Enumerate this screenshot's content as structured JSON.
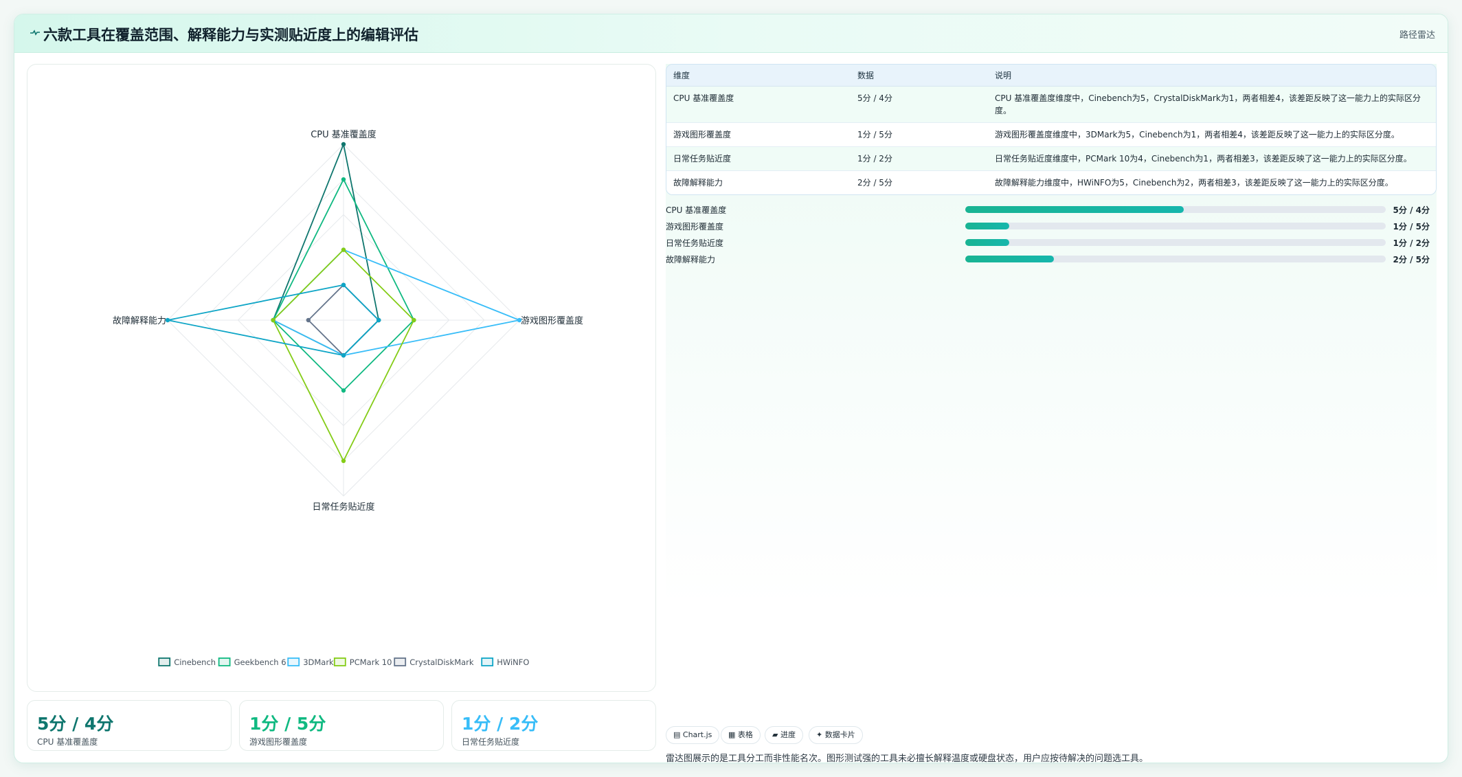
{
  "header": {
    "title": "六款工具在覆盖范围、解释能力与实测贴近度上的编辑评估",
    "tag": "路径雷达"
  },
  "chart_data": {
    "type": "radar",
    "axes": [
      "CPU 基准覆盖度",
      "游戏图形覆盖度",
      "日常任务贴近度",
      "故障解释能力"
    ],
    "range": [
      0,
      5
    ],
    "grid_levels": 5,
    "legend_position": "bottom",
    "series": [
      {
        "name": "Cinebench",
        "values": [
          5,
          1,
          1,
          2
        ],
        "color": "#0f766e"
      },
      {
        "name": "Geekbench 6",
        "values": [
          4,
          2,
          2,
          2
        ],
        "color": "#10b981"
      },
      {
        "name": "3DMark",
        "values": [
          2,
          5,
          1,
          2
        ],
        "color": "#38bdf8"
      },
      {
        "name": "PCMark 10",
        "values": [
          2,
          2,
          4,
          2
        ],
        "color": "#84cc16"
      },
      {
        "name": "CrystalDiskMark",
        "values": [
          1,
          1,
          1,
          1
        ],
        "color": "#64748b"
      },
      {
        "name": "HWiNFO",
        "values": [
          1,
          1,
          1,
          5
        ],
        "color": "#0ea5c6"
      }
    ]
  },
  "table": {
    "headers": [
      "维度",
      "数据",
      "说明"
    ],
    "rows": [
      [
        "CPU 基准覆盖度",
        "5分 / 4分",
        "CPU 基准覆盖度维度中，Cinebench为5，CrystalDiskMark为1，两者相差4，该差距反映了这一能力上的实际区分度。"
      ],
      [
        "游戏图形覆盖度",
        "1分 / 5分",
        "游戏图形覆盖度维度中，3DMark为5，Cinebench为1，两者相差4，该差距反映了这一能力上的实际区分度。"
      ],
      [
        "日常任务贴近度",
        "1分 / 2分",
        "日常任务贴近度维度中，PCMark 10为4，Cinebench为1，两者相差3，该差距反映了这一能力上的实际区分度。"
      ],
      [
        "故障解释能力",
        "2分 / 5分",
        "故障解释能力维度中，HWiNFO为5，Cinebench为2，两者相差3，该差距反映了这一能力上的实际区分度。"
      ]
    ]
  },
  "progress": [
    {
      "label": "CPU 基准覆盖度",
      "value": "5分 / 4分",
      "fraction": 0.52
    },
    {
      "label": "游戏图形覆盖度",
      "value": "1分 / 5分",
      "fraction": 0.105
    },
    {
      "label": "日常任务贴近度",
      "value": "1分 / 2分",
      "fraction": 0.105
    },
    {
      "label": "故障解释能力",
      "value": "2分 / 5分",
      "fraction": 0.21
    }
  ],
  "stats": [
    {
      "value": "5分 / 4分",
      "label": "CPU 基准覆盖度",
      "color": "#0f766e"
    },
    {
      "value": "1分 / 5分",
      "label": "游戏图形覆盖度",
      "color": "#10b981"
    },
    {
      "value": "1分 / 2分",
      "label": "日常任务贴近度",
      "color": "#38bdf8"
    }
  ],
  "chips": [
    "▤ Chart.js",
    "▦ 表格",
    "▰ 进度",
    "✦ 数据卡片"
  ],
  "note": "雷达图展示的是工具分工而非性能名次。图形测试强的工具未必擅长解释温度或硬盘状态，用户应按待解决的问题选工具。"
}
